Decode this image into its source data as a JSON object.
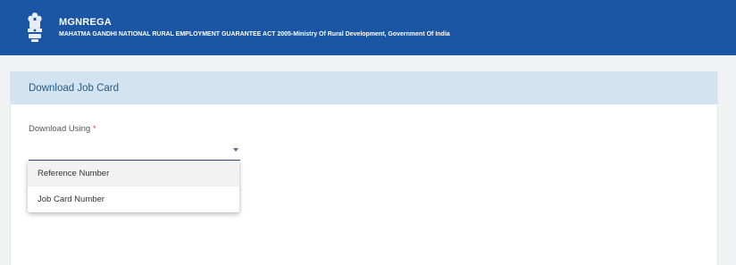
{
  "header": {
    "title": "MGNREGA",
    "subtitle": "MAHATMA GANDHI NATIONAL RURAL EMPLOYMENT GUARANTEE ACT 2005-Ministry Of Rural Development, Government Of India",
    "background_color": "#1b56a5",
    "emblem_icon": "national-emblem-icon"
  },
  "card": {
    "title": "Download Job Card",
    "header_color": "#d3e3ef"
  },
  "form": {
    "download_using": {
      "label": "Download Using",
      "required_marker": "*",
      "value": "",
      "options": [
        "Reference Number",
        "Job Card Number"
      ],
      "highlighted_option": "Reference Number"
    }
  }
}
